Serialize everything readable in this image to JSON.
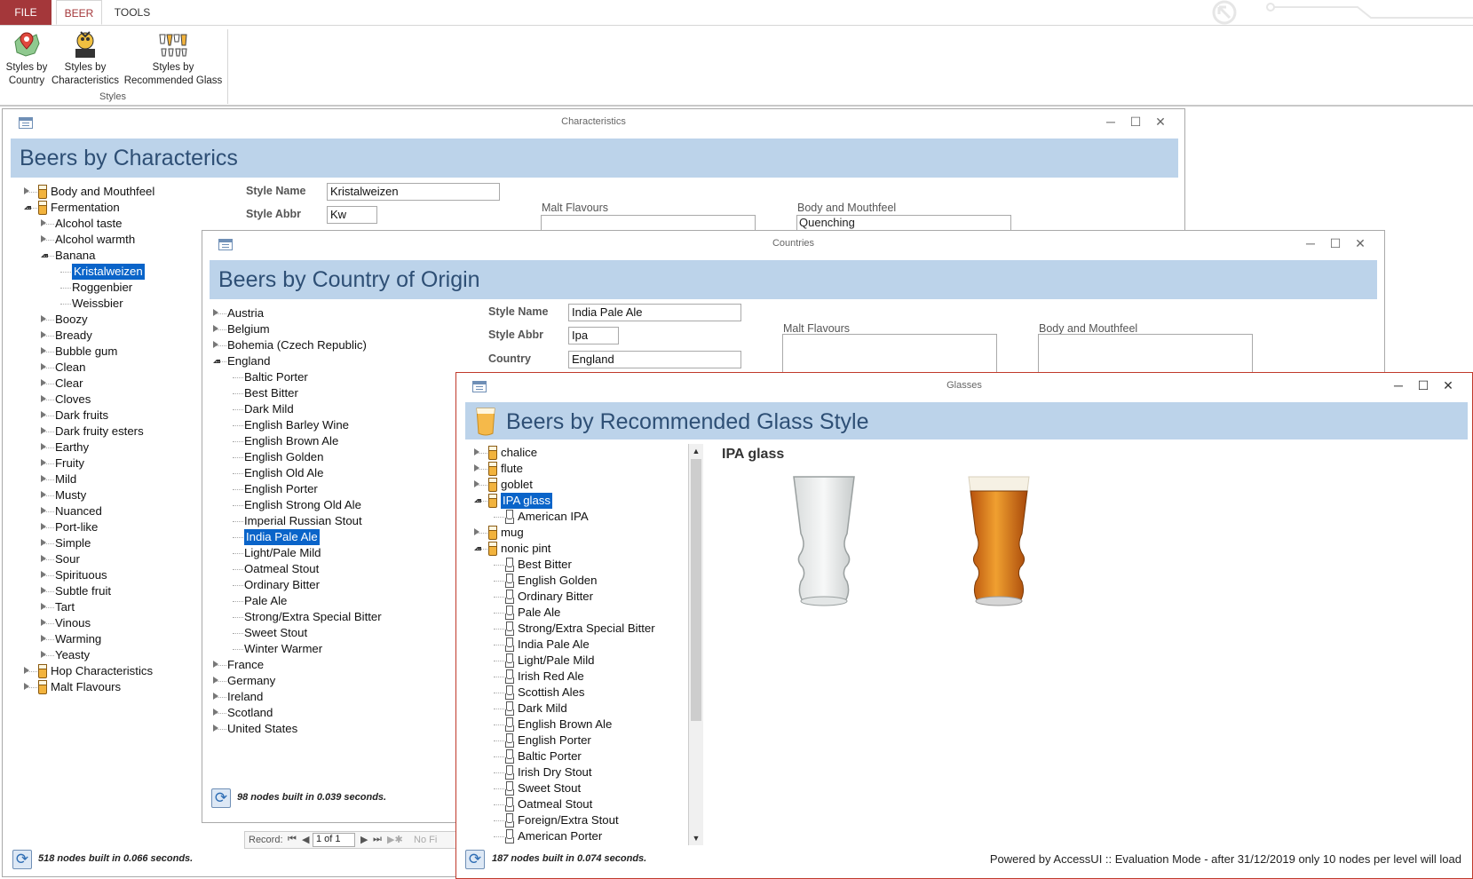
{
  "ribbon": {
    "tabs": [
      "FILE",
      "BEER",
      "TOOLS"
    ],
    "buttons": [
      {
        "line1": "Styles by",
        "line2": "Country"
      },
      {
        "line1": "Styles by",
        "line2": "Characteristics"
      },
      {
        "line1": "Styles by",
        "line2": "Recommended Glass"
      }
    ],
    "group_label": "Styles"
  },
  "characteristics": {
    "window_title": "Characteristics",
    "header": "Beers by Characterics",
    "style_name_label": "Style Name",
    "style_name": "Kristalweizen",
    "style_abbr_label": "Style Abbr",
    "style_abbr": "Kw",
    "malt_label": "Malt Flavours",
    "body_label": "Body and Mouthfeel",
    "body_value": "Quenching",
    "tree": {
      "body_mouthfeel": "Body and Mouthfeel",
      "fermentation": "Fermentation",
      "children_before": [
        "Alcohol taste",
        "Alcohol warmth"
      ],
      "banana": "Banana",
      "banana_children": [
        "Kristalweizen",
        "Roggenbier",
        "Weissbier"
      ],
      "children_after": [
        "Boozy",
        "Bready",
        "Bubble gum",
        "Clean",
        "Clear",
        "Cloves",
        "Dark fruits",
        "Dark fruity esters",
        "Earthy",
        "Fruity",
        "Mild",
        "Musty",
        "Nuanced",
        "Port-like",
        "Simple",
        "Sour",
        "Spirituous",
        "Subtle fruit",
        "Tart",
        "Vinous",
        "Warming",
        "Yeasty"
      ],
      "hop": "Hop Characteristics",
      "malt": "Malt Flavours"
    },
    "status": "518 nodes built in 0.066 seconds."
  },
  "countries": {
    "window_title": "Countries",
    "header": "Beers by Country of Origin",
    "style_name_label": "Style Name",
    "style_name": "India Pale Ale",
    "style_abbr_label": "Style Abbr",
    "style_abbr": "Ipa",
    "country_label": "Country",
    "country": "England",
    "malt_label": "Malt Flavours",
    "body_label": "Body and Mouthfeel",
    "tree": {
      "before": [
        "Austria",
        "Belgium",
        "Bohemia (Czech Republic)"
      ],
      "england": "England",
      "england_children": [
        "Baltic Porter",
        "Best Bitter",
        "Dark Mild",
        "English Barley Wine",
        "English Brown Ale",
        "English Golden",
        "English Old Ale",
        "English Porter",
        "English Strong Old Ale",
        "Imperial Russian Stout",
        "India Pale Ale",
        "Light/Pale Mild",
        "Oatmeal Stout",
        "Ordinary Bitter",
        "Pale Ale",
        "Strong/Extra Special Bitter",
        "Sweet Stout",
        "Winter Warmer"
      ],
      "after": [
        "France",
        "Germany",
        "Ireland",
        "Scotland",
        "United States"
      ]
    },
    "status": "98 nodes built in 0.039 seconds.",
    "record_label": "Record:",
    "record_value": "1 of 1",
    "no_filter": "No Fi"
  },
  "glasses": {
    "window_title": "Glasses",
    "header": "Beers by Recommended Glass Style",
    "selected_title": "IPA glass",
    "tree": {
      "before": [
        "chalice",
        "flute",
        "goblet"
      ],
      "ipa": "IPA glass",
      "ipa_children": [
        "American IPA"
      ],
      "mug": "mug",
      "nonic": "nonic pint",
      "nonic_children": [
        "Best Bitter",
        "English Golden",
        "Ordinary Bitter",
        "Pale Ale",
        "Strong/Extra Special Bitter",
        "India Pale Ale",
        "Light/Pale Mild",
        "Irish Red Ale",
        "Scottish Ales",
        "Dark Mild",
        "English Brown Ale",
        "English Porter",
        "Baltic Porter",
        "Irish Dry Stout",
        "Sweet Stout",
        "Oatmeal Stout",
        "Foreign/Extra Stout",
        "American Porter"
      ]
    },
    "status": "187 nodes built in 0.074 seconds.",
    "footer": "Powered by AccessUI :: Evaluation Mode - after 31/12/2019 only 10 nodes per level will load"
  },
  "colors": {
    "accent": "#a4373a",
    "header_bg": "#bcd3ea",
    "header_text": "#2e4f75",
    "selection": "#0a64c9"
  }
}
